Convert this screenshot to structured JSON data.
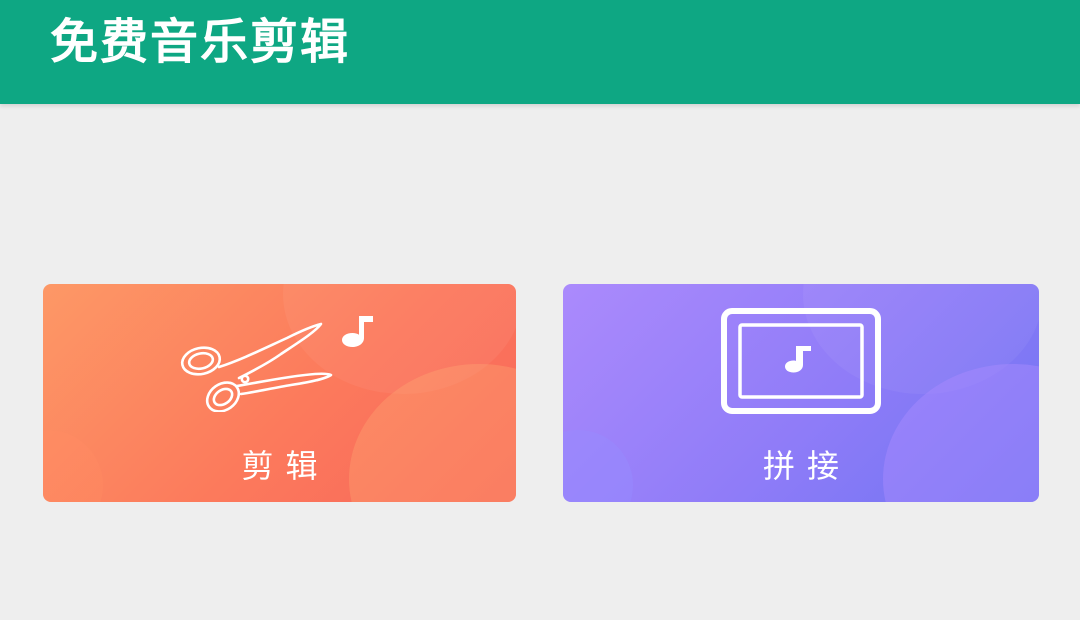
{
  "app_bar": {
    "title": "免费音乐剪辑",
    "color": "#0ea783"
  },
  "background": "#eeeeee",
  "cards": [
    {
      "label": "剪辑",
      "icon": "scissors-music-icon",
      "gradient": [
        "#fd9866",
        "#f8665a"
      ]
    },
    {
      "label": "拼接",
      "icon": "screen-music-icon",
      "gradient": [
        "#ab8afc",
        "#6f74f2"
      ]
    }
  ]
}
